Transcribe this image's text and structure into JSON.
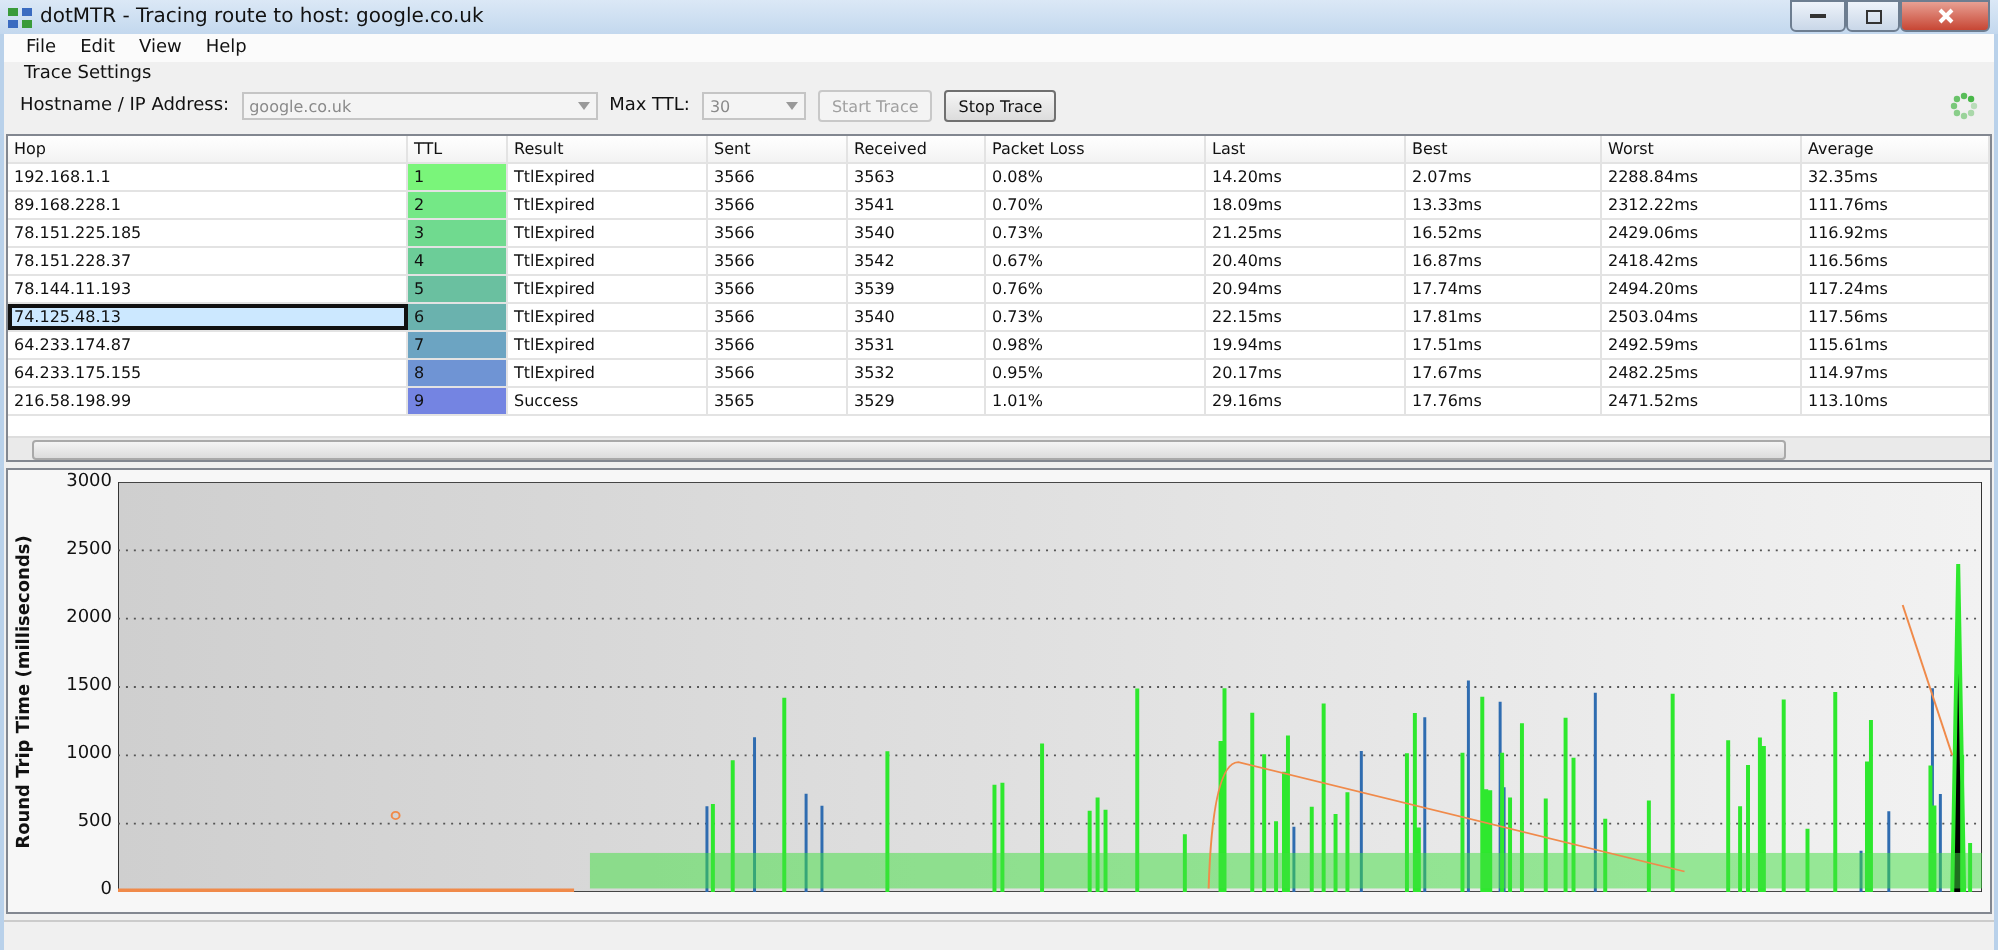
{
  "window": {
    "title": "dotMTR - Tracing route to host: google.co.uk"
  },
  "menu": [
    "File",
    "Edit",
    "View",
    "Help"
  ],
  "trace_settings": {
    "title": "Trace Settings",
    "host_label": "Hostname / IP Address:",
    "host_value": "google.co.uk",
    "ttl_label": "Max TTL:",
    "ttl_value": "30",
    "start_button": {
      "label": "Start Trace",
      "disabled": true
    },
    "stop_button": {
      "label": "Stop Trace",
      "disabled": false
    }
  },
  "table": {
    "columns": [
      "Hop",
      "TTL",
      "Result",
      "Sent",
      "Received",
      "Packet Loss",
      "Last",
      "Best",
      "Worst",
      "Average"
    ],
    "rows": [
      {
        "cells": [
          "192.168.1.1",
          "1",
          "TtlExpired",
          "3566",
          "3563",
          "0.08%",
          "14.20ms",
          "2.07ms",
          "2288.84ms",
          "32.35ms"
        ],
        "color": "#7af57a",
        "selected": false
      },
      {
        "cells": [
          "89.168.228.1",
          "2",
          "TtlExpired",
          "3566",
          "3541",
          "0.70%",
          "18.09ms",
          "13.33ms",
          "2312.22ms",
          "111.76ms"
        ],
        "color": "#74e886",
        "selected": false
      },
      {
        "cells": [
          "78.151.225.185",
          "3",
          "TtlExpired",
          "3566",
          "3540",
          "0.73%",
          "21.25ms",
          "16.52ms",
          "2429.06ms",
          "116.92ms"
        ],
        "color": "#70da8f",
        "selected": false
      },
      {
        "cells": [
          "78.151.228.37",
          "4",
          "TtlExpired",
          "3566",
          "3542",
          "0.67%",
          "20.40ms",
          "16.87ms",
          "2418.42ms",
          "116.56ms"
        ],
        "color": "#6ccd98",
        "selected": false
      },
      {
        "cells": [
          "78.144.11.193",
          "5",
          "TtlExpired",
          "3566",
          "3539",
          "0.76%",
          "20.94ms",
          "17.74ms",
          "2494.20ms",
          "117.24ms"
        ],
        "color": "#6ac0a0",
        "selected": false
      },
      {
        "cells": [
          "74.125.48.13",
          "6",
          "TtlExpired",
          "3566",
          "3540",
          "0.73%",
          "22.15ms",
          "17.81ms",
          "2503.04ms",
          "117.56ms"
        ],
        "color": "#6ab2ae",
        "selected": true
      },
      {
        "cells": [
          "64.233.174.87",
          "7",
          "TtlExpired",
          "3566",
          "3531",
          "0.98%",
          "19.94ms",
          "17.51ms",
          "2492.59ms",
          "115.61ms"
        ],
        "color": "#6ca4c2",
        "selected": false
      },
      {
        "cells": [
          "64.233.175.155",
          "8",
          "TtlExpired",
          "3566",
          "3532",
          "0.95%",
          "20.17ms",
          "17.67ms",
          "2482.25ms",
          "114.97ms"
        ],
        "color": "#6f94d4",
        "selected": false
      },
      {
        "cells": [
          "216.58.198.99",
          "9",
          "Success",
          "3565",
          "3529",
          "1.01%",
          "29.16ms",
          "17.76ms",
          "2471.52ms",
          "113.10ms"
        ],
        "color": "#7484e2",
        "selected": false
      }
    ]
  },
  "chart": {
    "ylabel": "Round Trip Time (milliseconds)",
    "yticks": [
      "3000",
      "2500",
      "2000",
      "1500",
      "1000",
      "500",
      "0"
    ]
  }
}
